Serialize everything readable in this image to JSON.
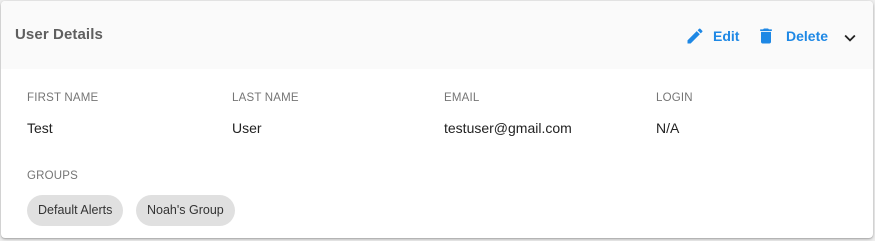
{
  "card": {
    "title": "User Details",
    "actions": {
      "edit_label": "Edit",
      "delete_label": "Delete"
    }
  },
  "fields": {
    "first_name": {
      "label": "FIRST NAME",
      "value": "Test"
    },
    "last_name": {
      "label": "LAST NAME",
      "value": "User"
    },
    "email": {
      "label": "EMAIL",
      "value": "testuser@gmail.com"
    },
    "login": {
      "label": "LOGIN",
      "value": "N/A"
    }
  },
  "groups": {
    "label": "GROUPS",
    "items": [
      "Default Alerts",
      "Noah's Group"
    ]
  },
  "icons": {
    "edit": "pencil-icon",
    "delete": "trash-icon",
    "collapse": "chevron-down-icon"
  },
  "colors": {
    "accent": "#1e88e5",
    "chip_bg": "#e0e0e0",
    "header_bg": "#fafafa"
  }
}
